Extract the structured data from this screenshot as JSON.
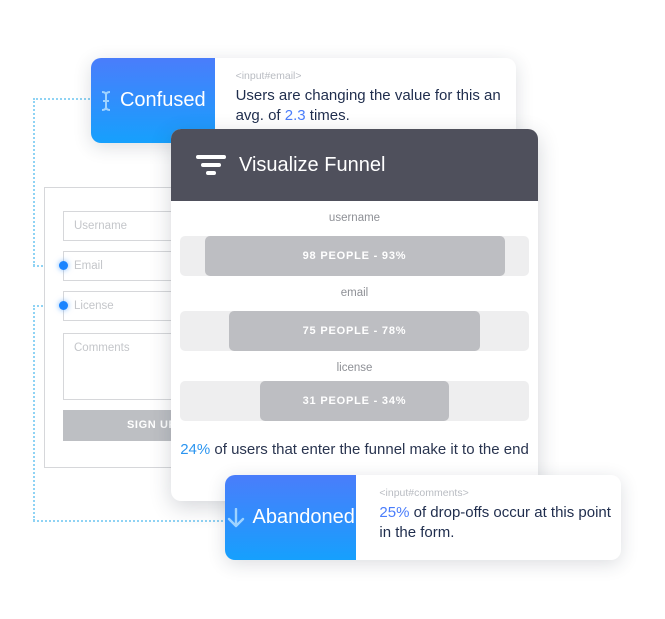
{
  "connector_color": "#8fd3f4",
  "accent_gradient": [
    "#4a7dfb",
    "#16a0fd"
  ],
  "form": {
    "fields": [
      {
        "placeholder": "Username",
        "highlighted": false
      },
      {
        "placeholder": "Email",
        "highlighted": true
      },
      {
        "placeholder": "License",
        "highlighted": true
      }
    ],
    "textarea_placeholder": "Comments",
    "submit_label": "SIGN UP"
  },
  "confused_card": {
    "icon": "text-cursor-icon",
    "icon_glyph": "I",
    "title": "Confused",
    "selector": "<input#email>",
    "message_pre": "Users are changing the value for this an avg. of ",
    "message_value": "2.3",
    "message_post": " times."
  },
  "funnel": {
    "title": "Visualize Funnel",
    "icon": "funnel-icon",
    "steps": [
      {
        "label": "username",
        "people": 98,
        "percent": 93,
        "text": "98 PEOPLE - 93%"
      },
      {
        "label": "email",
        "people": 75,
        "percent": 78,
        "text": "75 PEOPLE - 78%"
      },
      {
        "label": "license",
        "people": 31,
        "percent": 34,
        "text": "31 PEOPLE - 34%"
      }
    ],
    "summary_value": "24%",
    "summary_text": " of users that enter the funnel make it to the end"
  },
  "abandoned_card": {
    "icon": "arrow-down-icon",
    "icon_glyph": "↓",
    "title": "Abandoned",
    "selector": "<input#comments>",
    "message_value": "25%",
    "message_post": " of drop-offs occur at this point in the form."
  }
}
